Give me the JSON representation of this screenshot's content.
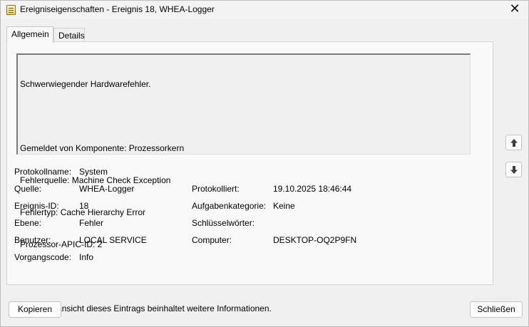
{
  "window": {
    "title": "Ereigniseigenschaften - Ereignis 18, WHEA-Logger"
  },
  "tabs": [
    {
      "label": "Allgemein",
      "active": true
    },
    {
      "label": "Details",
      "active": false
    }
  ],
  "description": {
    "lines": [
      "Schwerwiegender Hardwarefehler.",
      "",
      "Gemeldet von Komponente: Prozessorkern",
      "Fehlerquelle: Machine Check Exception",
      "Fehlertyp: Cache Hierarchy Error",
      "Prozessor-APIC-ID: 2",
      "",
      "Die Detailansicht dieses Eintrags beinhaltet weitere Informationen."
    ]
  },
  "fields": {
    "log_name": {
      "label": "Protokollname:",
      "value": "System"
    },
    "source": {
      "label": "Quelle:",
      "value": "WHEA-Logger"
    },
    "logged": {
      "label": "Protokolliert:",
      "value": "19.10.2025 18:46:44"
    },
    "event_id": {
      "label": "Ereignis-ID:",
      "value": "18"
    },
    "task_category": {
      "label": "Aufgabenkategorie:",
      "value": "Keine"
    },
    "level": {
      "label": "Ebene:",
      "value": "Fehler"
    },
    "keywords": {
      "label": "Schlüsselwörter:",
      "value": ""
    },
    "user": {
      "label": "Benutzer:",
      "value": "LOCAL SERVICE"
    },
    "computer": {
      "label": "Computer:",
      "value": "DESKTOP-OQ2P9FN"
    },
    "opcode": {
      "label": "Vorgangscode:",
      "value": "Info"
    }
  },
  "buttons": {
    "copy": "Kopieren",
    "close": "Schließen"
  },
  "icons": {
    "close": "close-icon",
    "up": "arrow-up-icon",
    "down": "arrow-down-icon",
    "app": "event-viewer-icon"
  }
}
